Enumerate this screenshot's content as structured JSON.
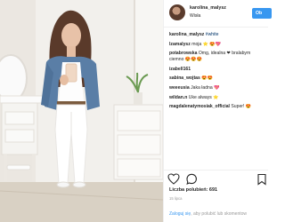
{
  "post": {
    "username": "karolina_malysz",
    "location": "Wisła",
    "follow_label": "Ob"
  },
  "comments": [
    {
      "user": "karolina_malysz",
      "text": "#white",
      "style": "tag"
    },
    {
      "user": "lzamalysz",
      "text": "moja ⭐ 😍💖"
    },
    {
      "user": "potabrowska",
      "text": "Omg, idealna ❤ bralabym ciemno 😍😍😍",
      "wrap": true
    },
    {
      "user": "izabell161",
      "text": ""
    },
    {
      "user": "sabina_wojtas",
      "text": "😍😍"
    },
    {
      "user": "weeeusia",
      "text": "Jaka ładna 💖"
    },
    {
      "user": "wildan.n",
      "text": "Uke always ⭐"
    },
    {
      "user": "magdalenatymosiak_official",
      "text": "Super! 😍"
    }
  ],
  "likes_label": "Liczba polubień: 691",
  "time_label": "15 lipca",
  "login_prefix": "Zaloguj się",
  "login_suffix": ", aby polubić lub skomentow",
  "icons": {
    "like": "heart-outline-icon",
    "comment": "comment-bubble-icon",
    "save": "bookmark-icon"
  }
}
